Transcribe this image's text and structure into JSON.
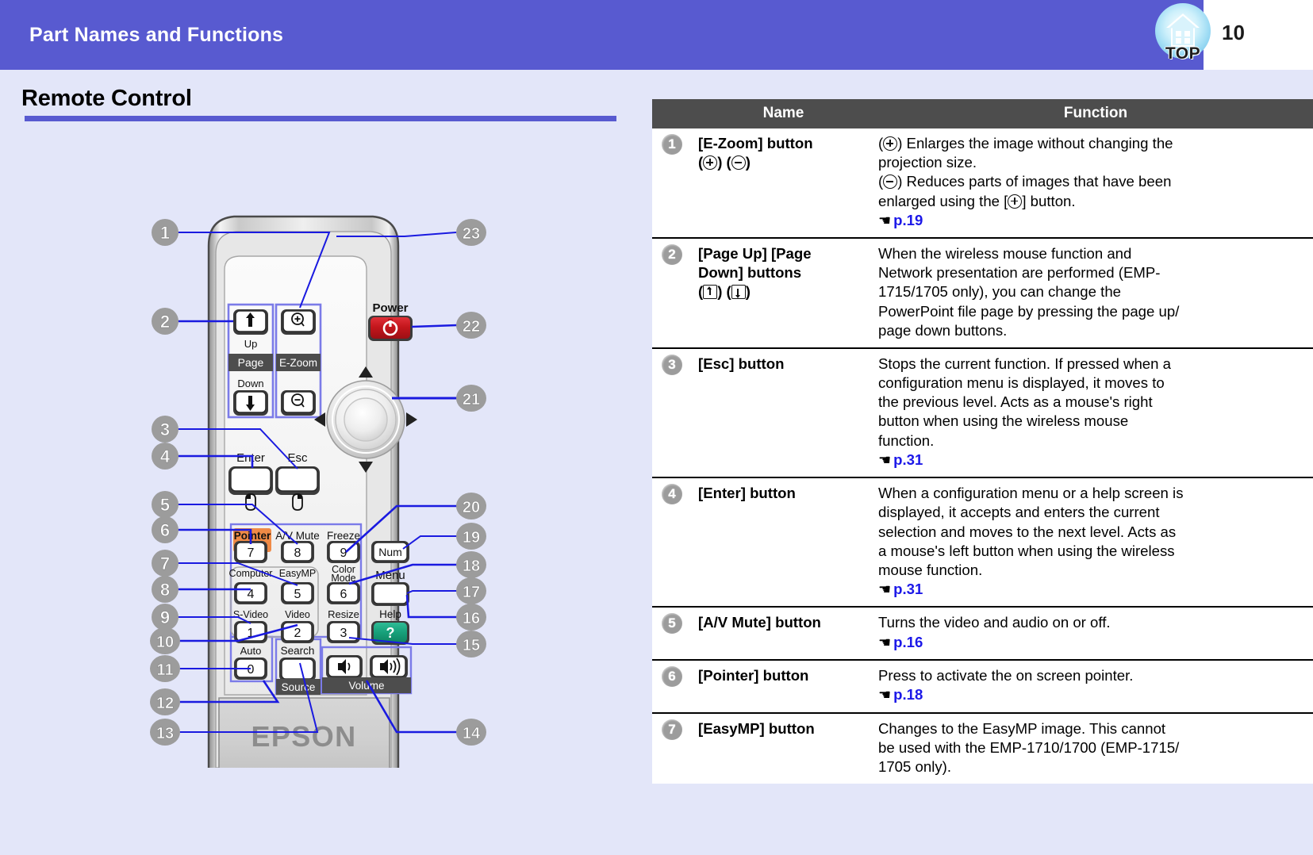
{
  "header": {
    "title": "Part Names and Functions",
    "page_number": "10",
    "top_icon_label": "TOP",
    "icon_name": "home-top-icon",
    "band_color": "#585AD0"
  },
  "section": {
    "title": "Remote Control",
    "rule_color": "#585AD0"
  },
  "table": {
    "headers": {
      "name": "Name",
      "function": "Function"
    },
    "rows": [
      {
        "num": "1",
        "name_line1": "[E-Zoom] button",
        "name_line2": "(⊕) (⊖)",
        "function_lines": [
          "(⊕) Enlarges the image without changing the",
          "projection size.",
          "(⊖) Reduces parts of images that have been",
          "enlarged using the [⊕] button."
        ],
        "link": "p.19"
      },
      {
        "num": "2",
        "name_line1": "[Page Up] [Page",
        "name_line2": "Down] buttons",
        "name_line3": "(⬆) (⬇)",
        "function_lines": [
          "When the wireless mouse function and",
          "Network presentation are performed (EMP-",
          "1715/1705 only), you can change the",
          "PowerPoint file page by pressing the page up/",
          "page down buttons."
        ],
        "link": ""
      },
      {
        "num": "3",
        "name_line1": "[Esc] button",
        "function_lines": [
          "Stops the current function. If pressed when a",
          "configuration menu is displayed, it moves to",
          "the previous level. Acts as a mouse's right",
          "button when using the wireless mouse",
          "function."
        ],
        "link": "p.31"
      },
      {
        "num": "4",
        "name_line1": "[Enter] button",
        "function_lines": [
          "When a configuration menu or a help screen is",
          "displayed, it accepts and enters the current",
          "selection and moves to the next level.  Acts as",
          "a mouse's left button when using the wireless",
          "mouse function."
        ],
        "link": "p.31"
      },
      {
        "num": "5",
        "name_line1": "[A/V Mute] button",
        "function_lines": [
          "Turns the video and audio on or off."
        ],
        "link": "p.16"
      },
      {
        "num": "6",
        "name_line1": "[Pointer] button",
        "function_lines": [
          "Press to activate the on screen pointer."
        ],
        "link": "p.18"
      },
      {
        "num": "7",
        "name_line1": "[EasyMP] button",
        "function_lines": [
          "Changes to the EasyMP image. This cannot",
          "be used with the EMP-1710/1700 (EMP-1715/",
          "1705 only)."
        ],
        "link": ""
      }
    ]
  },
  "remote": {
    "brand": "EPSON",
    "labels": {
      "power": "Power",
      "page": "Page",
      "up": "Up",
      "down": "Down",
      "ezoom": "E-Zoom",
      "enter": "Enter",
      "esc": "Esc",
      "pointer": "Pointer",
      "avmute": "A/V Mute",
      "freeze": "Freeze",
      "num": "Num",
      "computer": "Computer",
      "easymp": "EasyMP",
      "colormode_l1": "Color",
      "colormode_l2": "Mode",
      "menu": "Menu",
      "svideo": "S-Video",
      "video": "Video",
      "resize": "Resize",
      "help": "Help",
      "auto": "Auto",
      "search": "Search",
      "source": "Source",
      "volume": "Volume"
    },
    "keys": {
      "k7": "7",
      "k8": "8",
      "k9": "9",
      "k4": "4",
      "k5": "5",
      "k6": "6",
      "k1": "1",
      "k2": "2",
      "k3": "3",
      "k0": "0",
      "help_glyph": "?"
    },
    "callouts_left": [
      "1",
      "2",
      "3",
      "4",
      "5",
      "6",
      "7",
      "8",
      "9",
      "10",
      "11",
      "12",
      "13"
    ],
    "callouts_right": [
      "23",
      "22",
      "21",
      "20",
      "19",
      "18",
      "17",
      "16",
      "15",
      "14"
    ],
    "colors": {
      "power_red": "#C4161C",
      "help_green": "#17A07A",
      "pointer_orange": "#F08A46",
      "highlight_box": "#7B7BE8",
      "callout_gray": "#9C9C9C",
      "leader_blue": "#1A1AE0",
      "body_gray": "#BFBFBF"
    }
  }
}
